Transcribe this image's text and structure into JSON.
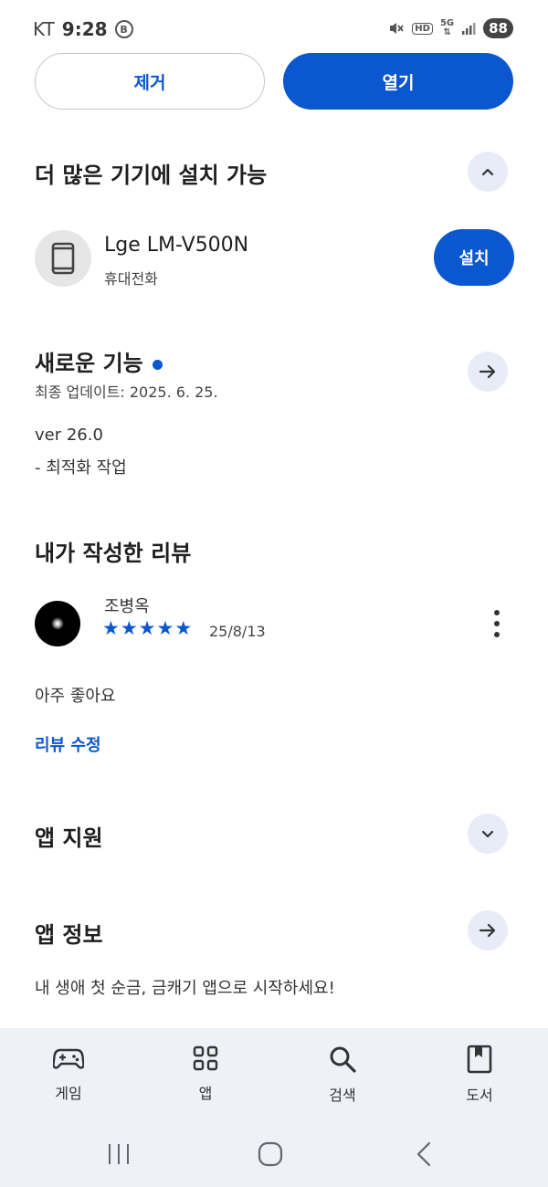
{
  "status_bar": {
    "carrier": "KT",
    "time": "9:28",
    "coin_icon": "B",
    "hd": "HD",
    "network": "5G",
    "battery": "88"
  },
  "actions": {
    "remove_label": "제거",
    "open_label": "열기"
  },
  "install_more": {
    "title": "더 많은 기기에 설치 가능",
    "device_name": "Lge LM-V500N",
    "device_type": "휴대전화",
    "install_label": "설치"
  },
  "whats_new": {
    "title": "새로운 기능",
    "last_update": "최종 업데이트: 2025. 6. 25.",
    "version": "ver 26.0",
    "note": "- 최적화 작업"
  },
  "my_review": {
    "title": "내가 작성한 리뷰",
    "reviewer": "조병옥",
    "rating": 5,
    "date": "25/8/13",
    "text": "아주 좋아요",
    "edit_label": "리뷰 수정"
  },
  "app_support": {
    "title": "앱 지원"
  },
  "app_info": {
    "title": "앱 정보",
    "description": "내 생애 첫 순금, 금캐기 앱으로 시작하세요!"
  },
  "bottom_nav": {
    "items": [
      {
        "label": "게임",
        "icon": "gamepad-icon"
      },
      {
        "label": "앱",
        "icon": "apps-grid-icon"
      },
      {
        "label": "검색",
        "icon": "search-icon"
      },
      {
        "label": "도서",
        "icon": "book-icon"
      }
    ]
  },
  "colors": {
    "accent": "#0b57d0",
    "circle_button_bg": "#e8ecf7",
    "nav_bg": "#eef1f8"
  }
}
